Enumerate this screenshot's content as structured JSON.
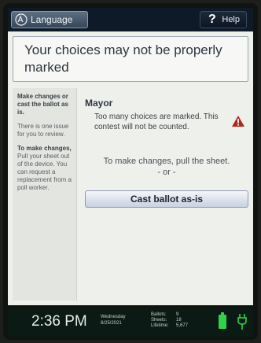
{
  "header": {
    "language_label": "Language",
    "help_label": "Help",
    "help_symbol": "?"
  },
  "banner": {
    "title": "Your choices may not be properly marked"
  },
  "sidebar": {
    "heading": "Make changes or cast the ballot as is.",
    "issue_text": "There is one issue for you to review.",
    "make_changes_bold": "To make changes,",
    "make_changes_text": "Pull your sheet out of the device. You can request a replacement from a poll worker."
  },
  "contest": {
    "title": "Mayor",
    "warning": "Too many choices are marked. This contest will not be counted.",
    "instruction": "To make changes, pull the sheet.",
    "separator": "- or -",
    "cast_button": "Cast ballot as-is"
  },
  "status_bar": {
    "time": "2:36 PM",
    "weekday": "Wednesday",
    "date": "8/25/2021",
    "ballots_label": "Ballots:",
    "ballots_value": "9",
    "sheets_label": "Sheets:",
    "sheets_value": "18",
    "lifetime_label": "Lifetime:",
    "lifetime_value": "5,677"
  },
  "icons": {
    "warning": "warning-triangle-icon",
    "battery": "battery-icon",
    "power": "power-plug-icon",
    "language": "language-icon"
  },
  "colors": {
    "warning_red": "#b3261e",
    "battery_green": "#2fd24a",
    "header_bg": "#0e1a28",
    "status_bg": "#0b1a14"
  }
}
